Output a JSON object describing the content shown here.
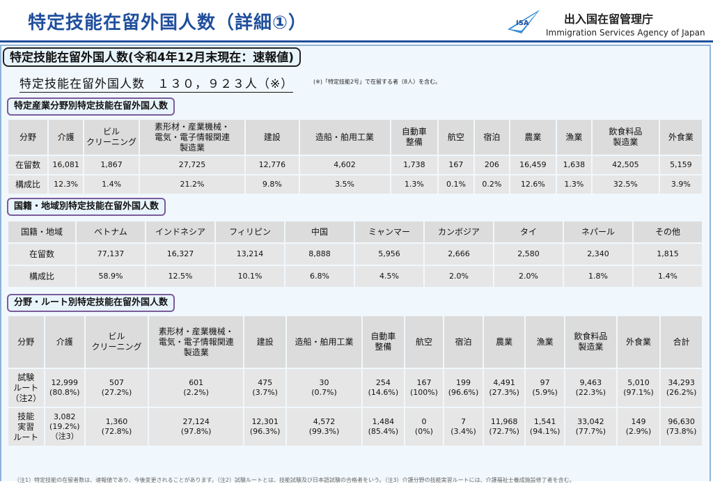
{
  "header": {
    "title": "特定技能在留外国人数（詳細①）",
    "agency_jp": "出入国在留管理庁",
    "agency_en": "Immigration Services Agency of Japan",
    "logo_text": "ISA"
  },
  "panel_title": "特定技能在留外国人数(令和4年12月末現在：速報値)",
  "total": {
    "text": "特定技能在留外国人数　１３０，９２３人（※）",
    "note": "(※)「特定技能2号」で在留する者（8人）を含む。"
  },
  "section1": {
    "title": "特定産業分野別特定技能在留外国人数",
    "headers": [
      "分野",
      "介護",
      "ビル\nクリーニング",
      "素形材・産業機械・\n電気・電子情報関連\n製造業",
      "建設",
      "造船・舶用工業",
      "自動車\n整備",
      "航空",
      "宿泊",
      "農業",
      "漁業",
      "飲食料品\n製造業",
      "外食業"
    ],
    "rows": [
      [
        "在留数",
        "16,081",
        "1,867",
        "27,725",
        "12,776",
        "4,602",
        "1,738",
        "167",
        "206",
        "16,459",
        "1,638",
        "42,505",
        "5,159"
      ],
      [
        "構成比",
        "12.3%",
        "1.4%",
        "21.2%",
        "9.8%",
        "3.5%",
        "1.3%",
        "0.1%",
        "0.2%",
        "12.6%",
        "1.3%",
        "32.5%",
        "3.9%"
      ]
    ]
  },
  "section2": {
    "title": "国籍・地域別特定技能在留外国人数",
    "headers": [
      "国籍・地域",
      "ベトナム",
      "インドネシア",
      "フィリピン",
      "中国",
      "ミャンマー",
      "カンボジア",
      "タイ",
      "ネパール",
      "その他"
    ],
    "rows": [
      [
        "在留数",
        "77,137",
        "16,327",
        "13,214",
        "8,888",
        "5,956",
        "2,666",
        "2,580",
        "2,340",
        "1,815"
      ],
      [
        "構成比",
        "58.9%",
        "12.5%",
        "10.1%",
        "6.8%",
        "4.5%",
        "2.0%",
        "2.0%",
        "1.8%",
        "1.4%"
      ]
    ]
  },
  "section3": {
    "title": "分野・ルート別特定技能在留外国人数",
    "headers": [
      "分野",
      "介護",
      "ビル\nクリーニング",
      "素形材・産業機械・\n電気・電子情報関連\n製造業",
      "建設",
      "造船・舶用工業",
      "自動車\n整備",
      "航空",
      "宿泊",
      "農業",
      "漁業",
      "飲食料品\n製造業",
      "外食業",
      "合計"
    ],
    "rows": [
      [
        "試験\nルート\n（注2）",
        "12,999\n(80.8%)",
        "507\n(27.2%)",
        "601\n(2.2%)",
        "475\n(3.7%)",
        "30\n(0.7%)",
        "254\n(14.6%)",
        "167\n(100%)",
        "199\n(96.6%)",
        "4,491\n(27.3%)",
        "97\n(5.9%)",
        "9,463\n(22.3%)",
        "5,010\n(97.1%)",
        "34,293\n(26.2%)"
      ],
      [
        "技能\n実習\nルート",
        "3,082\n(19.2%)\n（注3）",
        "1,360\n(72.8%)",
        "27,124\n(97.8%)",
        "12,301\n(96.3%)",
        "4,572\n(99.3%)",
        "1,484\n(85.4%)",
        "0\n(0%)",
        "7\n(3.4%)",
        "11,968\n(72.7%)",
        "1,541\n(94.1%)",
        "33,042\n(77.7%)",
        "149\n(2.9%)",
        "96,630\n(73.8%)"
      ]
    ]
  },
  "footer_note": "（注1）特定技能の在留者数は、速報値であり、今後変更されることがあります。（注2）試験ルートとは、技能試験及び日本語試験の合格者をいう。（注3）介護分野の技能実習ルートには、介護福祉士養成施設修了者を含む。"
}
